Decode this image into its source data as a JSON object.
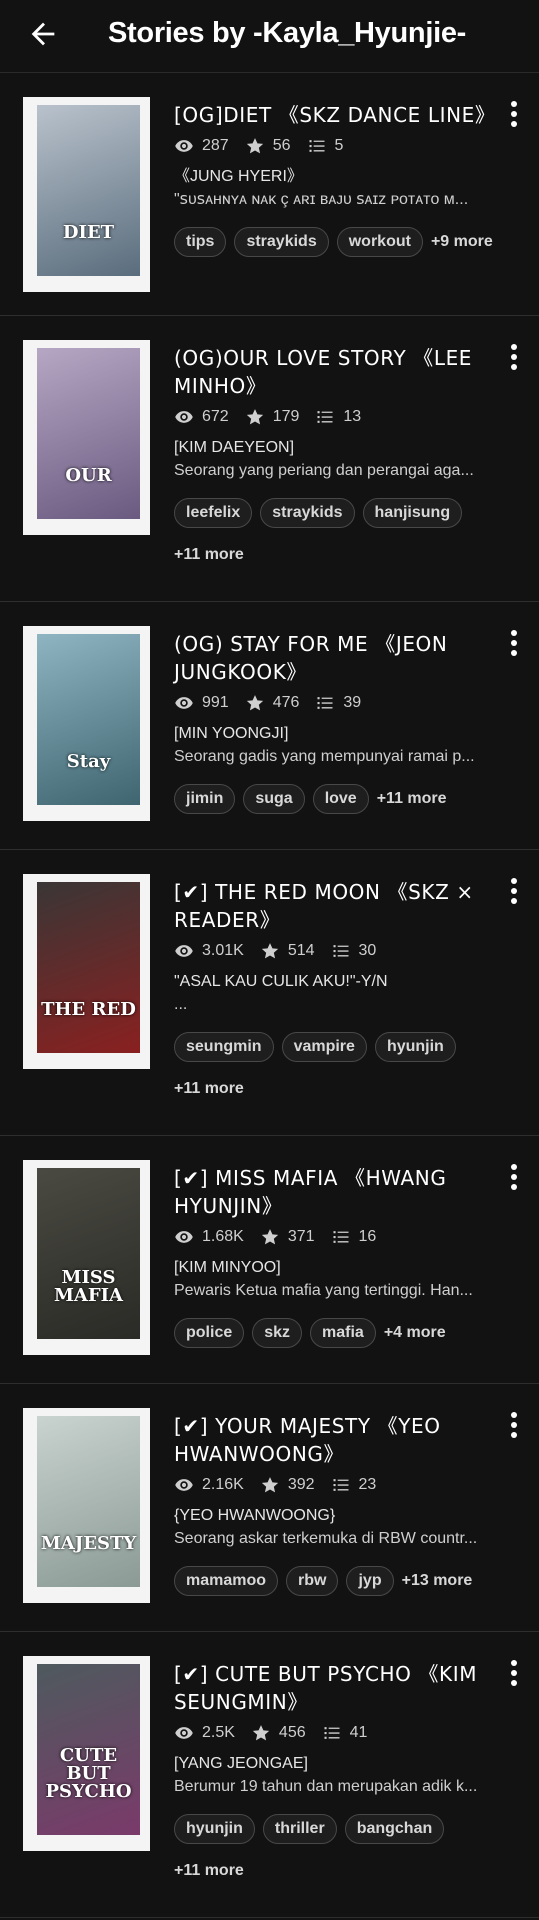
{
  "header": {
    "title": "Stories by -Kayla_Hyunjie-",
    "back_icon": "back-arrow-icon"
  },
  "stories": [
    {
      "title": "[OG]DIET 《SKZ DANCE LINE》",
      "reads": "287",
      "votes": "56",
      "parts": "5",
      "character": "《JUNG HYERI》",
      "desc": "\"ꜱᴜꜱᴀʜɴʏᴀ ɴᴀᴋ ç ᴀʀɪ ʙᴀᴊᴜ ꜱᴀɪᴢ ᴘᴏᴛᴀᴛᴏ ᴍ...",
      "tags": [
        "tips",
        "straykids",
        "workout"
      ],
      "more": "+9 more",
      "cover": {
        "text": "DIET",
        "bg": "#b9c2cc",
        "accent": "#5a6d7d"
      }
    },
    {
      "title": "(OG)OUR LOVE STORY 《LEE MINHO》",
      "reads": "672",
      "votes": "179",
      "parts": "13",
      "character": "[KIM DAEYEON]",
      "desc": "Seorang yang periang dan perangai aga...",
      "tags": [
        "leefelix",
        "straykids",
        "hanjisung"
      ],
      "more": "+11 more",
      "cover": {
        "text": "OUR",
        "bg": "#b6a7c4",
        "accent": "#6a5a80"
      }
    },
    {
      "title": "(OG) STAY FOR ME 《JEON JUNGKOOK》",
      "reads": "991",
      "votes": "476",
      "parts": "39",
      "character": "[MIN YOONGJI]",
      "desc": "Seorang gadis yang mempunyai ramai p...",
      "tags": [
        "jimin",
        "suga",
        "love"
      ],
      "more": "+11 more",
      "cover": {
        "text": "Stay",
        "bg": "#8fb4c2",
        "accent": "#3e6570"
      }
    },
    {
      "title": "[✔] THE RED MOON 《SKZ × READER》",
      "reads": "3.01K",
      "votes": "514",
      "parts": "30",
      "character": "\"ASAL KAU CULIK AKU!\"-Y/N",
      "desc": "...",
      "tags": [
        "seungmin",
        "vampire",
        "hyunjin"
      ],
      "more": "+11 more",
      "cover": {
        "text": "THE RED",
        "bg": "#3a3636",
        "accent": "#8a2020"
      }
    },
    {
      "title": "[✔] MISS MAFIA 《HWANG HYUNJIN》",
      "reads": "1.68K",
      "votes": "371",
      "parts": "16",
      "character": "[KIM MINYOO]",
      "desc": "Pewaris Ketua mafia yang tertinggi. Han...",
      "tags": [
        "police",
        "skz",
        "mafia"
      ],
      "more": "+4 more",
      "cover": {
        "text": "MISS MAFIA",
        "bg": "#4a4a42",
        "accent": "#2a2a26"
      }
    },
    {
      "title": "[✔] YOUR MAJESTY 《YEO HWANWOONG》",
      "reads": "2.16K",
      "votes": "392",
      "parts": "23",
      "character": "{YEO HWANWOONG}",
      "desc": "Seorang askar terkemuka di RBW countr...",
      "tags": [
        "mamamoo",
        "rbw",
        "jyp"
      ],
      "more": "+13 more",
      "cover": {
        "text": "MAJESTY",
        "bg": "#c9d3cf",
        "accent": "#8b9a95"
      }
    },
    {
      "title": "[✔] CUTE BUT PSYCHO 《KIM SEUNGMIN》",
      "reads": "2.5K",
      "votes": "456",
      "parts": "41",
      "character": "[YANG JEONGAE]",
      "desc": "Berumur 19 tahun dan merupakan adik k...",
      "tags": [
        "hyunjin",
        "thriller",
        "bangchan"
      ],
      "more": "+11 more",
      "cover": {
        "text": "CUTE BUT PSYCHO",
        "bg": "#4e5a5e",
        "accent": "#7a3a6a"
      }
    }
  ]
}
